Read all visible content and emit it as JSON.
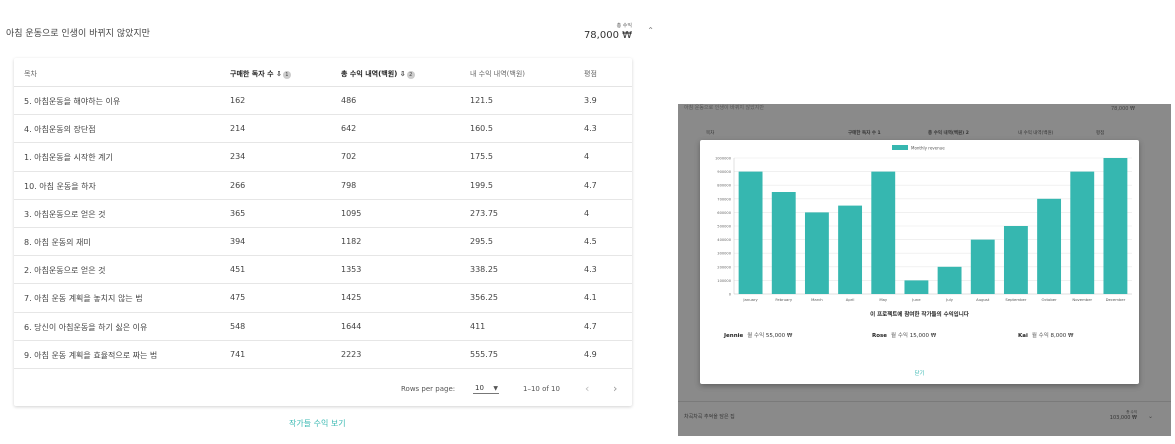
{
  "left_panel": {
    "title": "아침 운동으로 인생이 바뀌지 않았지만",
    "revenue_label": "총 수익",
    "revenue_value": "78,000 ₩",
    "expand_icon": "expand-icon",
    "columns": {
      "chapter": "목차",
      "buyers": "구매한 독자 수",
      "buyers_info": "1",
      "total_rev": "총 수익 내역(백원)",
      "total_rev_info": "2",
      "my_rev": "내 수익 내역(백원)",
      "rating": "평점"
    },
    "rows": [
      {
        "chapter": "5. 아침운동을 해야하는 이유",
        "buyers": "162",
        "total": "486",
        "mine": "121.5",
        "rating": "3.9"
      },
      {
        "chapter": "4. 아침운동의 장단점",
        "buyers": "214",
        "total": "642",
        "mine": "160.5",
        "rating": "4.3"
      },
      {
        "chapter": "1. 아침운동을 시작한 계기",
        "buyers": "234",
        "total": "702",
        "mine": "175.5",
        "rating": "4"
      },
      {
        "chapter": "10. 아침 운동을 하자",
        "buyers": "266",
        "total": "798",
        "mine": "199.5",
        "rating": "4.7"
      },
      {
        "chapter": "3. 아침운동으로 얻은 것",
        "buyers": "365",
        "total": "1095",
        "mine": "273.75",
        "rating": "4"
      },
      {
        "chapter": "8. 아침 운동의 재미",
        "buyers": "394",
        "total": "1182",
        "mine": "295.5",
        "rating": "4.5"
      },
      {
        "chapter": "2. 아침운동으로 얻은 것",
        "buyers": "451",
        "total": "1353",
        "mine": "338.25",
        "rating": "4.3"
      },
      {
        "chapter": "7. 아침 운동 계획을 놓치지 않는 법",
        "buyers": "475",
        "total": "1425",
        "mine": "356.25",
        "rating": "4.1"
      },
      {
        "chapter": "6. 당신이 아침운동을 하기 싫은 이유",
        "buyers": "548",
        "total": "1644",
        "mine": "411",
        "rating": "4.7"
      },
      {
        "chapter": "9. 아침 운동 계획을 효율적으로 짜는 법",
        "buyers": "741",
        "total": "2223",
        "mine": "555.75",
        "rating": "4.9"
      }
    ],
    "pagination": {
      "rows_per_page_label": "Rows per page:",
      "rows_per_page_value": "10",
      "range": "1–10 of 10"
    },
    "link": "작가들 수익 보기"
  },
  "right_panel": {
    "bg_title": "아침 운동으로 인생이 바뀌지 않았지만",
    "bg_revenue": "78,000 ₩",
    "bg_columns": [
      "목차",
      "구매한 독자 수 1",
      "총 수익 내역(백원) 2",
      "내 수익 내역(백원)",
      "평점"
    ],
    "bg_footer_title": "차곡차곡 추억을 담은 집",
    "bg_footer_rev_label": "총 수익",
    "bg_footer_rev_value": "103,000 ₩",
    "modal": {
      "caption": "이 프로젝트에 참여한 작가들의 수익입니다",
      "close": "닫기",
      "authors": [
        {
          "name": "Jennie",
          "label": "월 수익",
          "value": "55,000 ₩"
        },
        {
          "name": "Rose",
          "label": "월 수익",
          "value": "15,000 ₩"
        },
        {
          "name": "Kai",
          "label": "월 수익",
          "value": "8,000 ₩"
        }
      ]
    }
  },
  "colors": {
    "accent": "#3cbab3",
    "bar": "#36b7b0",
    "overlay": "#8a8a8a"
  },
  "chart_data": {
    "type": "bar",
    "categories": [
      "January",
      "February",
      "March",
      "April",
      "May",
      "June",
      "July",
      "August",
      "September",
      "October",
      "November",
      "December"
    ],
    "series": [
      {
        "name": "Monthly revenue",
        "values": [
          900000,
          750000,
          600000,
          650000,
          900000,
          100000,
          200000,
          400000,
          500000,
          700000,
          900000,
          1000000
        ]
      }
    ],
    "ylim": [
      0,
      1000000
    ],
    "yticks": [
      "0",
      "100000",
      "200000",
      "300000",
      "400000",
      "500000",
      "600000",
      "700000",
      "800000",
      "900000",
      "1000000"
    ],
    "legend": "top-center",
    "grid": true
  }
}
